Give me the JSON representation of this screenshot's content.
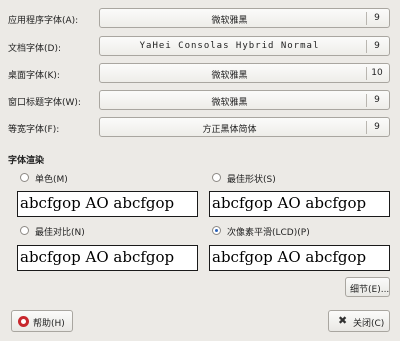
{
  "font_rows": [
    {
      "label": "应用程序字体(A):",
      "font": "微软雅黑",
      "size": "9"
    },
    {
      "label": "文档字体(D):",
      "font": "YaHei Consolas Hybrid Normal",
      "size": "9"
    },
    {
      "label": "桌面字体(K):",
      "font": "微软雅黑",
      "size": "10"
    },
    {
      "label": "窗口标题字体(W):",
      "font": "微软雅黑",
      "size": "9"
    },
    {
      "label": "等宽字体(F):",
      "font": "方正黑体简体",
      "size": "9"
    }
  ],
  "rendering": {
    "title": "字体渲染",
    "preview_text": "abcfgop AO abcfgop",
    "options": [
      {
        "label": "单色(M)",
        "checked": false
      },
      {
        "label": "最佳形状(S)",
        "checked": false
      },
      {
        "label": "最佳对比(N)",
        "checked": false
      },
      {
        "label": "次像素平滑(LCD)(P)",
        "checked": true
      }
    ]
  },
  "buttons": {
    "details": "细节(E)...",
    "help": "帮助(H)",
    "close": "关闭(C)"
  }
}
